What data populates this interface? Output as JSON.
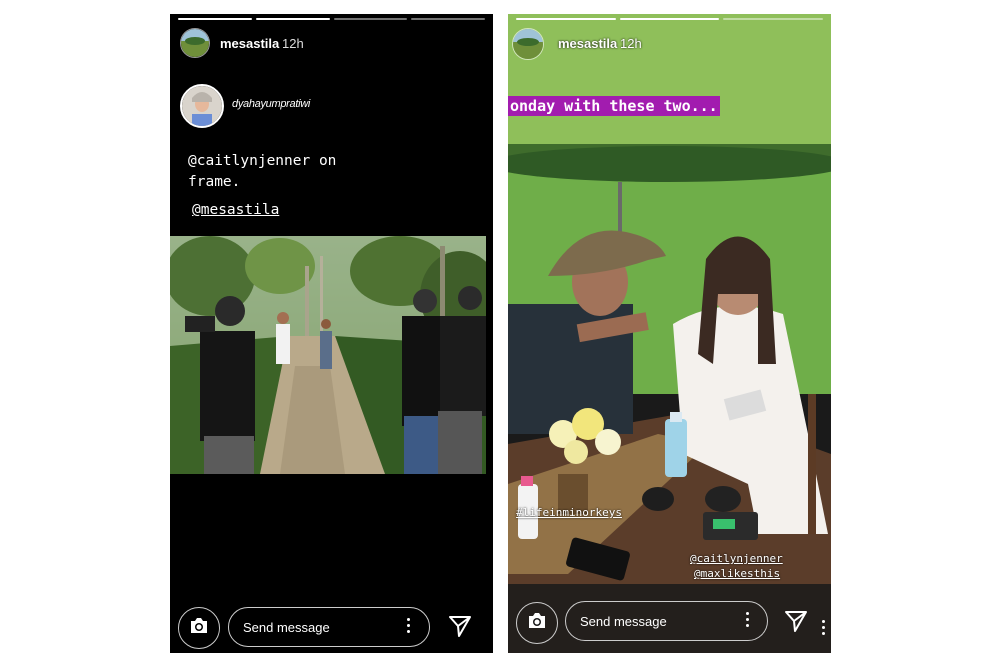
{
  "story_left": {
    "username": "mesastila",
    "time": "12h",
    "reposted_username": "dyahayumpratiwi",
    "caption_lines": [
      "@caitlynjenner on",
      "frame."
    ],
    "mention": "@mesastila",
    "send_placeholder": "Send message"
  },
  "story_right": {
    "username": "mesastila",
    "time": "12h",
    "banner_text": "onday with these two...",
    "hashtag": "#lifeinminorkeys",
    "mention_1": "@caitlynjenner",
    "mention_2": "@maxlikesthis",
    "send_placeholder": "Send message"
  },
  "colors": {
    "banner_purple": "#a21caf",
    "grass_green": "#6fae49"
  },
  "icons": [
    "camera-icon",
    "more-vertical-icon",
    "send-icon"
  ]
}
